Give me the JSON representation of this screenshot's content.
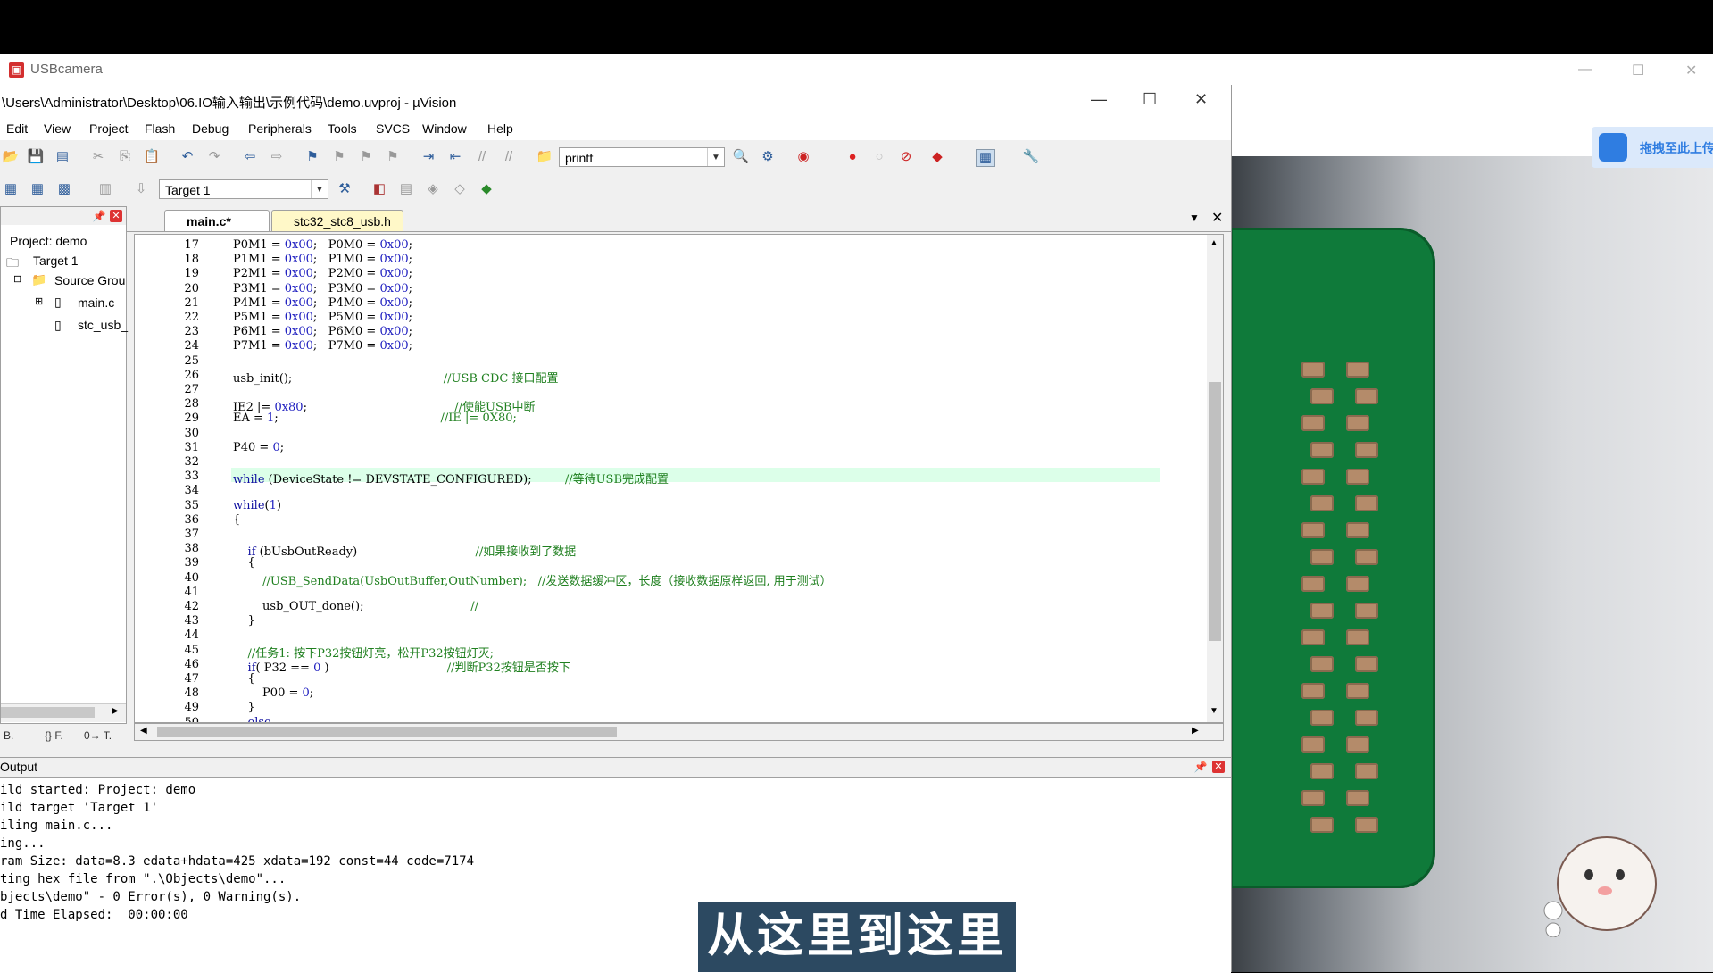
{
  "camera_window": {
    "title": "USBcamera",
    "minimize": "—",
    "maximize": "☐",
    "close": "✕",
    "cloud_button_label": "拖拽至此上传"
  },
  "uvision": {
    "title": "\\Users\\Administrator\\Desktop\\06.IO输入输出\\示例代码\\demo.uvproj - µVision",
    "minimize": "—",
    "maximize": "☐",
    "close": "✕",
    "menu": [
      "Edit",
      "View",
      "Project",
      "Flash",
      "Debug",
      "Peripherals",
      "Tools",
      "SVCS",
      "Window",
      "Help"
    ],
    "find_combo_value": "printf",
    "target_combo_value": "Target 1",
    "project": {
      "header": "Project: demo",
      "target": "Target 1",
      "group": "Source Grou",
      "files": [
        "main.c",
        "stc_usb_"
      ]
    },
    "project_tabs": [
      "B.",
      "{} F.",
      "0→ T."
    ],
    "tabs": [
      "main.c*",
      "stc32_stc8_usb.h"
    ],
    "code_lines": [
      {
        "n": "17",
        "html": "P0M1 = <span class='num'>0x00</span>;   P0M0 = <span class='num'>0x00</span>;"
      },
      {
        "n": "18",
        "html": "P1M1 = <span class='num'>0x00</span>;   P1M0 = <span class='num'>0x00</span>;"
      },
      {
        "n": "19",
        "html": "P2M1 = <span class='num'>0x00</span>;   P2M0 = <span class='num'>0x00</span>;"
      },
      {
        "n": "20",
        "html": "P3M1 = <span class='num'>0x00</span>;   P3M0 = <span class='num'>0x00</span>;"
      },
      {
        "n": "21",
        "html": "P4M1 = <span class='num'>0x00</span>;   P4M0 = <span class='num'>0x00</span>;"
      },
      {
        "n": "22",
        "html": "P5M1 = <span class='num'>0x00</span>;   P5M0 = <span class='num'>0x00</span>;"
      },
      {
        "n": "23",
        "html": "P6M1 = <span class='num'>0x00</span>;   P6M0 = <span class='num'>0x00</span>;"
      },
      {
        "n": "24",
        "html": "P7M1 = <span class='num'>0x00</span>;   P7M0 = <span class='num'>0x00</span>;"
      },
      {
        "n": "25",
        "html": ""
      },
      {
        "n": "26",
        "html": "usb_init();                                         <span class='cm'>//USB CDC 接口配置</span>"
      },
      {
        "n": "27",
        "html": ""
      },
      {
        "n": "28",
        "html": "IE2 |= <span class='num'>0x80</span>;                                        <span class='cm'>//使能USB中断</span>"
      },
      {
        "n": "29",
        "html": "EA = <span class='num'>1</span>;                                            <span class='cm'>//IE |= 0X80;</span>"
      },
      {
        "n": "30",
        "html": ""
      },
      {
        "n": "31",
        "html": "P40 = <span class='num'>0</span>;"
      },
      {
        "n": "32",
        "html": ""
      },
      {
        "n": "33",
        "html": "<span class='kw'>while</span> (DeviceState != DEVSTATE_CONFIGURED);         <span class='cm'>//等待USB完成配置</span>"
      },
      {
        "n": "34",
        "html": ""
      },
      {
        "n": "35",
        "html": "<span class='kw'>while</span>(<span class='num'>1</span>)"
      },
      {
        "n": "36",
        "html": "{"
      },
      {
        "n": "37",
        "html": ""
      },
      {
        "n": "38",
        "html": "    <span class='kw'>if</span> (bUsbOutReady)                                <span class='cm'>//如果接收到了数据</span>"
      },
      {
        "n": "39",
        "html": "    {"
      },
      {
        "n": "40",
        "html": "        <span class='cm'>//USB_SendData(UsbOutBuffer,OutNumber);   //发送数据缓冲区，长度（接收数据原样返回, 用于测试）</span>"
      },
      {
        "n": "41",
        "html": ""
      },
      {
        "n": "42",
        "html": "        usb_OUT_done();                             <span class='cm'>//</span>"
      },
      {
        "n": "43",
        "html": "    }"
      },
      {
        "n": "44",
        "html": ""
      },
      {
        "n": "45",
        "html": "    <span class='cm'>//任务1: 按下P32按钮灯亮，松开P32按钮灯灭;</span>"
      },
      {
        "n": "46",
        "html": "    <span class='kw'>if</span>( P32 == <span class='num'>0</span> )                                <span class='cm'>//判断P32按钮是否按下</span>"
      },
      {
        "n": "47",
        "html": "    {"
      },
      {
        "n": "48",
        "html": "        P00 = <span class='num'>0</span>;"
      },
      {
        "n": "49",
        "html": "    }"
      },
      {
        "n": "50",
        "html": "    <span class='kw'>else</span>"
      }
    ],
    "output": {
      "header": "Output",
      "lines": [
        "ild started: Project: demo",
        "ild target 'Target 1'",
        "iling main.c...",
        "ing...",
        "ram Size: data=8.3 edata+hdata=425 xdata=192 const=44 code=7174",
        "ting hex file from \".\\Objects\\demo\"...",
        "bjects\\demo\" - 0 Error(s), 0 Warning(s).",
        "d Time Elapsed:  00:00:00"
      ]
    }
  },
  "subtitle": "从这里到这里"
}
